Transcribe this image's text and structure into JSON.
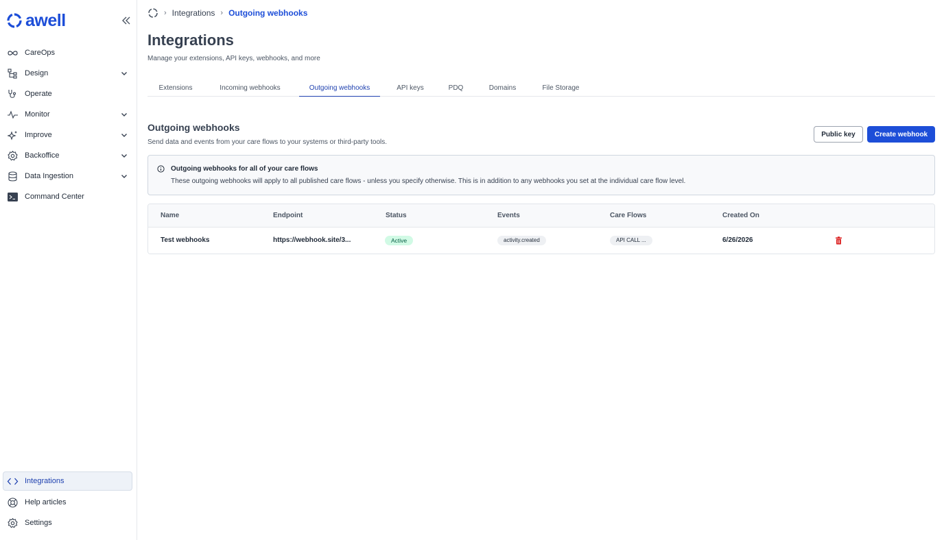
{
  "app": {
    "logo_text": "awell",
    "brand_color": "#1d4ed8"
  },
  "sidebar": {
    "items": [
      {
        "label": "CareOps",
        "icon": "infinity-icon",
        "expandable": false
      },
      {
        "label": "Design",
        "icon": "hierarchy-icon",
        "expandable": true
      },
      {
        "label": "Operate",
        "icon": "stethoscope-icon",
        "expandable": false
      },
      {
        "label": "Monitor",
        "icon": "activity-icon",
        "expandable": true
      },
      {
        "label": "Improve",
        "icon": "sparkles-icon",
        "expandable": true
      },
      {
        "label": "Backoffice",
        "icon": "gear-icon",
        "expandable": true
      },
      {
        "label": "Data Ingestion",
        "icon": "database-icon",
        "expandable": true
      },
      {
        "label": "Command Center",
        "icon": "terminal-icon",
        "expandable": false
      }
    ],
    "bottom_items": [
      {
        "label": "Integrations",
        "icon": "code-icon",
        "active": true
      },
      {
        "label": "Help articles",
        "icon": "lifebuoy-icon",
        "active": false
      },
      {
        "label": "Settings",
        "icon": "gear-icon",
        "active": false
      }
    ]
  },
  "breadcrumb": {
    "items": [
      "Integrations",
      "Outgoing webhooks"
    ]
  },
  "page": {
    "title": "Integrations",
    "subtitle": "Manage your extensions, API keys, webhooks, and more"
  },
  "tabs": [
    {
      "label": "Extensions"
    },
    {
      "label": "Incoming webhooks"
    },
    {
      "label": "Outgoing webhooks",
      "active": true
    },
    {
      "label": "API keys"
    },
    {
      "label": "PDQ"
    },
    {
      "label": "Domains"
    },
    {
      "label": "File Storage"
    }
  ],
  "section": {
    "title": "Outgoing webhooks",
    "subtitle": "Send data and events from your care flows to your systems or third-party tools.",
    "public_key_label": "Public key",
    "create_label": "Create webhook"
  },
  "info": {
    "title": "Outgoing webhooks for all of your care flows",
    "text": "These outgoing webhooks will apply to all published care flows - unless you specify otherwise. This is in addition to any webhooks you set at the individual care flow level."
  },
  "table": {
    "columns": [
      "Name",
      "Endpoint",
      "Status",
      "Events",
      "Care Flows",
      "Created On"
    ],
    "rows": [
      {
        "name": "Test webhooks",
        "endpoint": "https://webhook.site/3...",
        "status": "Active",
        "events": "activity.created",
        "care_flows": "API CALL ...",
        "created_on": "6/26/2026"
      }
    ]
  }
}
